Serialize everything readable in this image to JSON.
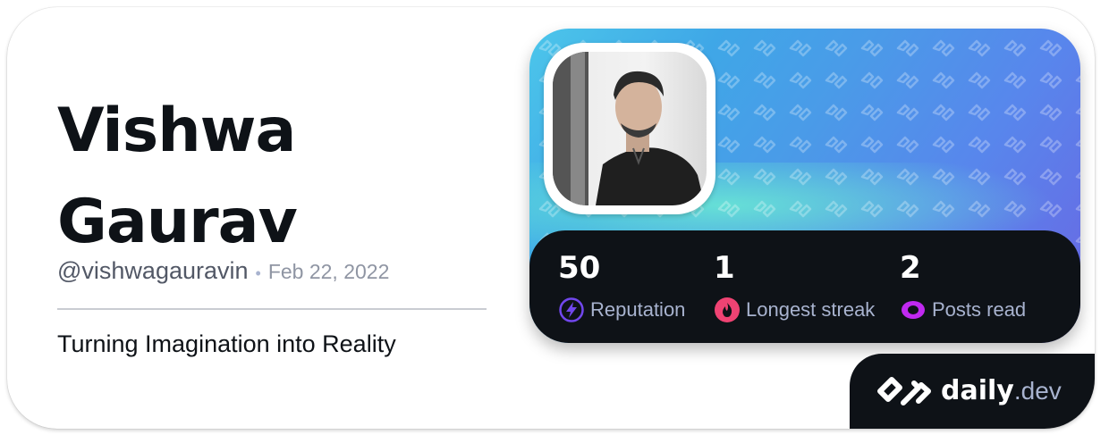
{
  "profile": {
    "name": "Vishwa Gaurav",
    "handle": "@vishwagauravin",
    "separator": "•",
    "joined": "Feb 22, 2022",
    "bio": "Turning Imagination into Reality"
  },
  "stats": [
    {
      "value": "50",
      "label": "Reputation",
      "icon": "bolt-icon",
      "color": "#7147ed"
    },
    {
      "value": "1",
      "label": "Longest streak",
      "icon": "flame-icon",
      "color": "#ef4373"
    },
    {
      "value": "2",
      "label": "Posts read",
      "icon": "eye-icon",
      "color": "#c029f0"
    }
  ],
  "brand": {
    "daily": "daily",
    "dev": ".dev"
  },
  "colors": {
    "panel": "#0e1217",
    "text_primary": "#0e1217",
    "text_secondary": "#525866",
    "stat_label": "#a8b3cf"
  }
}
